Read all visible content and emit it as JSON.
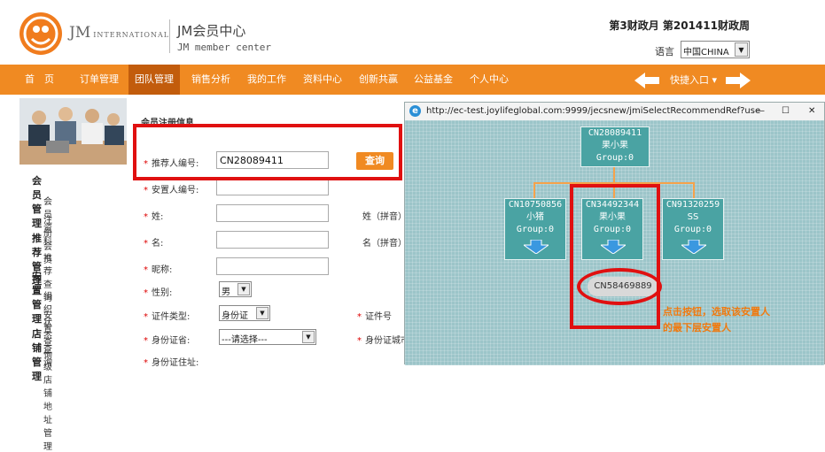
{
  "header": {
    "brand": "JM",
    "brand_suffix": "INTERNATIONAL",
    "center_title": "JM会员中心",
    "center_subtitle": "JM member center",
    "fiscal": "第3财政月 第201411财政周",
    "language_label": "语言",
    "language_value": "中国CHINA"
  },
  "nav": {
    "items": [
      "首　页",
      "订单管理",
      "团队管理",
      "销售分析",
      "我的工作",
      "资料中心",
      "创新共赢",
      "公益基金",
      "个人中心"
    ],
    "active_index": 2,
    "quick_entry": "快捷入口 ▾"
  },
  "sidebar": {
    "groups": [
      {
        "title": "会员管理",
        "items": [
          "会员资料",
          "注册会员"
        ]
      },
      {
        "title": "推荐管理",
        "items": [
          "推荐查询"
        ]
      },
      {
        "title": "安置管理",
        "items": [
          "组织状态查询",
          "安置查询"
        ]
      },
      {
        "title": "店铺管理",
        "items": [
          "一级店铺地址管理"
        ]
      }
    ]
  },
  "form": {
    "section_title": "会员注册信息",
    "referrer_label": "推荐人编号:",
    "referrer_value": "CN28089411",
    "query_button": "查询",
    "placement_label": "安置人编号:",
    "surname_label": "姓:",
    "surname_pinyin_label": "姓（拼音）",
    "name_label": "名:",
    "name_pinyin_label": "名（拼音）",
    "nickname_label": "昵称:",
    "gender_label": "性别:",
    "gender_value": "男",
    "id_type_label": "证件类型:",
    "id_type_value": "身份证",
    "id_number_label": "证件号",
    "province_label": "身份证省:",
    "province_value": "---请选择---",
    "city_label": "身份证城市",
    "address_label": "身份证住址:"
  },
  "popup": {
    "url": "http://ec-test.joylifeglobal.com:9999/jecsnew/jmiSelectRecommendRef?use",
    "tree": {
      "root": {
        "id": "CN28089411",
        "name": "果小果",
        "group": "Group:0"
      },
      "children": [
        {
          "id": "CN10750856",
          "name": "小猪",
          "group": "Group:0"
        },
        {
          "id": "CN34492344",
          "name": "果小果",
          "group": "Group:0"
        },
        {
          "id": "CN91320259",
          "name": "SS",
          "group": "Group:0"
        }
      ],
      "leaf": "CN58469889"
    },
    "annotation": [
      "点击按钮，选取该安置人",
      "的最下层安置人"
    ]
  },
  "colors": {
    "accent": "#f08a22",
    "active_tab": "#c25c0c",
    "highlight": "#e01010",
    "node": "#4aa3a3"
  }
}
